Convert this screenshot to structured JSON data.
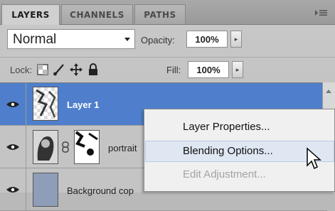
{
  "tabs": [
    {
      "label": "LAYERS",
      "active": true
    },
    {
      "label": "CHANNELS",
      "active": false
    },
    {
      "label": "PATHS",
      "active": false
    }
  ],
  "panel_menu_icon": "panel-menu-icon",
  "blend_mode": {
    "value": "Normal"
  },
  "opacity": {
    "label": "Opacity:",
    "value": "100%"
  },
  "lock": {
    "label": "Lock:"
  },
  "fill": {
    "label": "Fill:",
    "value": "100%"
  },
  "layers": [
    {
      "name": "Layer 1",
      "selected": true
    },
    {
      "name": "portrait",
      "selected": false
    },
    {
      "name": "Background cop",
      "selected": false
    }
  ],
  "context_menu": {
    "items": [
      {
        "label": "Layer Properties...",
        "state": "normal"
      },
      {
        "label": "Blending Options...",
        "state": "hover"
      },
      {
        "label": "Edit Adjustment...",
        "state": "disabled"
      }
    ]
  },
  "colors": {
    "selection": "#4f7fcc",
    "panel": "#c9c9c9",
    "menu_bg": "#f0f0f0"
  }
}
